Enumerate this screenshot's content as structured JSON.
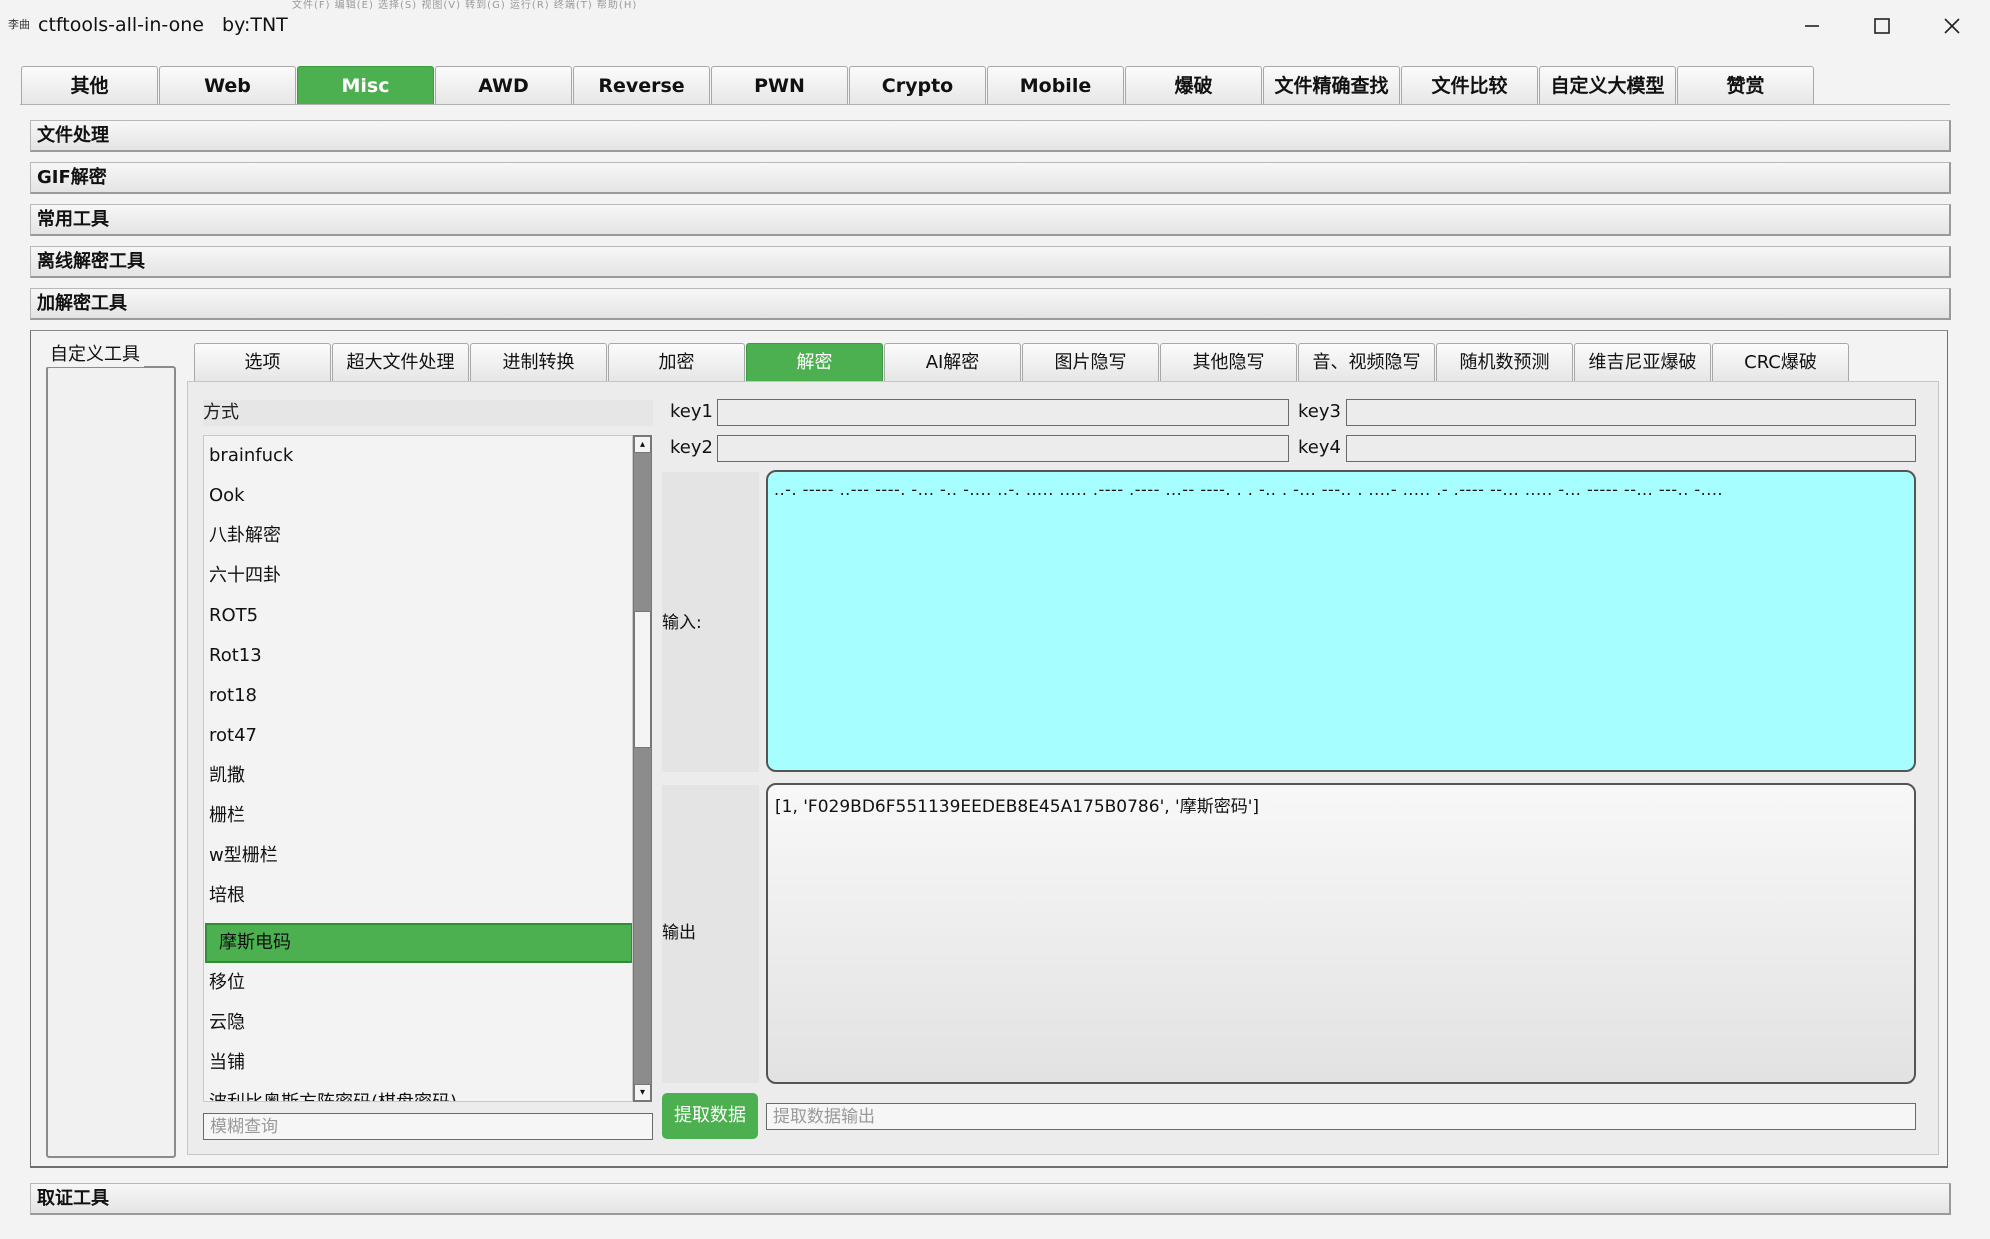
{
  "window": {
    "icon_text": "李曲",
    "title": "ctftools-all-in-one   by:TNT",
    "ghost_menu": "文件(F)  编辑(E)  选择(S)  视图(V)  转到(G)  运行(R)  终端(T)  帮助(H)"
  },
  "top_tabs": [
    {
      "label": "其他",
      "active": false
    },
    {
      "label": "Web",
      "active": false
    },
    {
      "label": "Misc",
      "active": true
    },
    {
      "label": "AWD",
      "active": false
    },
    {
      "label": "Reverse",
      "active": false
    },
    {
      "label": "PWN",
      "active": false
    },
    {
      "label": "Crypto",
      "active": false
    },
    {
      "label": "Mobile",
      "active": false
    },
    {
      "label": "爆破",
      "active": false
    },
    {
      "label": "文件精确查找",
      "active": false
    },
    {
      "label": "文件比较",
      "active": false
    },
    {
      "label": "自定义大模型",
      "active": false
    },
    {
      "label": "赞赏",
      "active": false
    }
  ],
  "sections": [
    "文件处理",
    "GIF解密",
    "常用工具",
    "离线解密工具",
    "加解密工具"
  ],
  "bottom_section": "取证工具",
  "custom_tools_label": "自定义工具",
  "inner_tabs": [
    {
      "label": "选项",
      "active": false
    },
    {
      "label": "超大文件处理",
      "active": false
    },
    {
      "label": "进制转换",
      "active": false
    },
    {
      "label": "加密",
      "active": false
    },
    {
      "label": "解密",
      "active": true
    },
    {
      "label": "AI解密",
      "active": false
    },
    {
      "label": "图片隐写",
      "active": false
    },
    {
      "label": "其他隐写",
      "active": false
    },
    {
      "label": "音、视频隐写",
      "active": false
    },
    {
      "label": "随机数预测",
      "active": false
    },
    {
      "label": "维吉尼亚爆破",
      "active": false
    },
    {
      "label": "CRC爆破",
      "active": false
    }
  ],
  "method_header": "方式",
  "methods": [
    {
      "label": "brainfuck",
      "selected": false
    },
    {
      "label": "Ook",
      "selected": false
    },
    {
      "label": "八卦解密",
      "selected": false
    },
    {
      "label": "六十四卦",
      "selected": false
    },
    {
      "label": "ROT5",
      "selected": false
    },
    {
      "label": "Rot13",
      "selected": false
    },
    {
      "label": "rot18",
      "selected": false
    },
    {
      "label": "rot47",
      "selected": false
    },
    {
      "label": "凯撒",
      "selected": false
    },
    {
      "label": "栅栏",
      "selected": false
    },
    {
      "label": "w型栅栏",
      "selected": false
    },
    {
      "label": "培根",
      "selected": false
    },
    {
      "label": "摩斯电码",
      "selected": true
    },
    {
      "label": "移位",
      "selected": false
    },
    {
      "label": "云隐",
      "selected": false
    },
    {
      "label": "当铺",
      "selected": false
    },
    {
      "label": "波利比奥斯方阵密码(棋盘密码)",
      "selected": false
    }
  ],
  "fuzzy_search_placeholder": "模糊查询",
  "keys": {
    "key1_label": "key1",
    "key1_value": "",
    "key2_label": "key2",
    "key2_value": "",
    "key3_label": "key3",
    "key3_value": "",
    "key4_label": "key4",
    "key4_value": ""
  },
  "input_label": "输入:",
  "input_value": "..-. ----- ..--- ----. -... -.. -.... ..-. ..... ..... .---- .---- ...-- ----. . . -.. . -... ---.. . ....- ..... .- .---- --... ..... -... ----- --... ---.. -....",
  "output_label": "输出",
  "output_value": "[1, 'F029BD6F551139EEDEB8E45A175B0786', '摩斯密码']",
  "extract_button": "提取数据",
  "extract_output_placeholder": "提取数据输出",
  "colors": {
    "accent": "#4cb050",
    "input_bg": "#a7fefe"
  }
}
